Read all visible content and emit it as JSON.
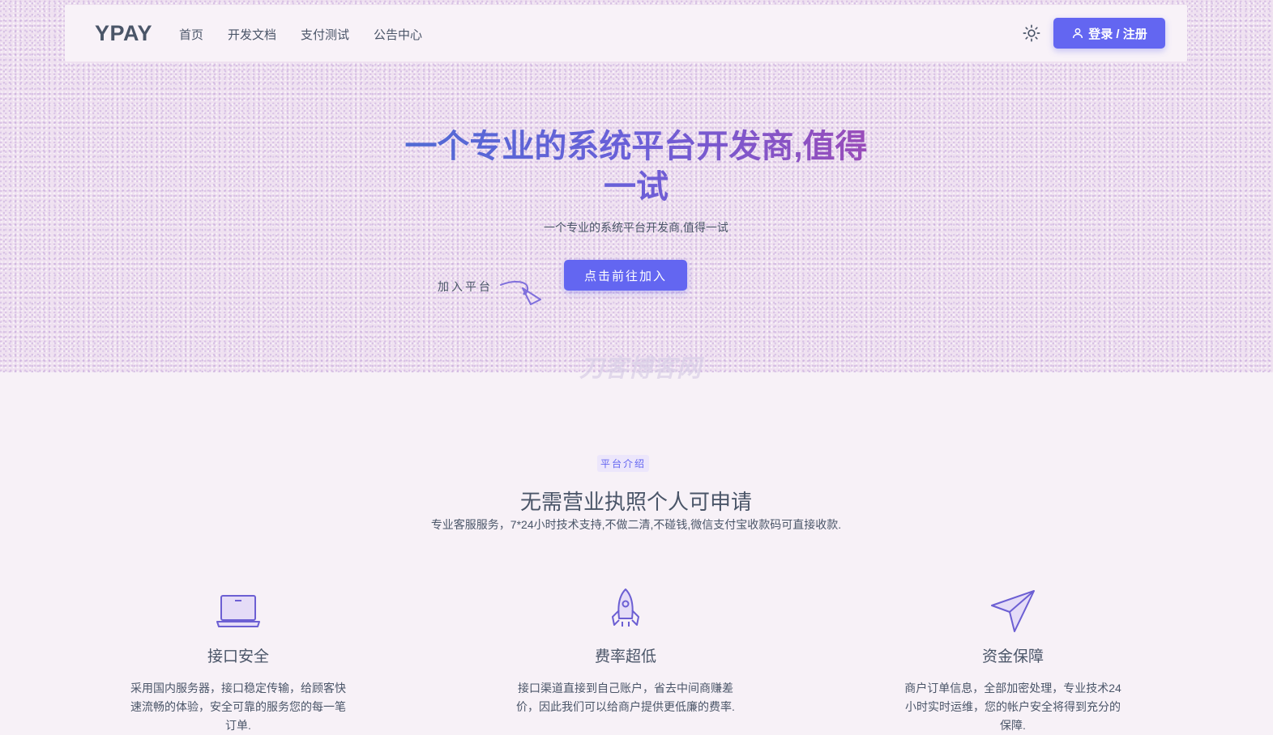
{
  "header": {
    "logo": "YPAY",
    "nav": [
      "首页",
      "开发文档",
      "支付测试",
      "公告中心"
    ],
    "theme_toggle_icon": "sun-icon",
    "login_label": "登录 / 注册",
    "login_icon": "user-icon"
  },
  "hero": {
    "title": "一个专业的系统平台开发商,值得一试",
    "subtitle": "一个专业的系统平台开发商,值得一试",
    "join_label": "加入平台",
    "cta_label": "点击前往加入",
    "watermark": "刀客博客网"
  },
  "intro": {
    "badge": "平台介绍",
    "title": "无需营业执照个人可申请",
    "subtitle": "专业客服服务，7*24小时技术支持,不做二清,不碰钱,微信支付宝收款码可直接收款."
  },
  "features": [
    {
      "icon": "laptop-icon",
      "title": "接口安全",
      "desc": "采用国内服务器，接口稳定传输，给顾客快速流畅的体验，安全可靠的服务您的每一笔订单."
    },
    {
      "icon": "rocket-icon",
      "title": "费率超低",
      "desc": "接口渠道直接到自己账户，省去中间商赚差价，因此我们可以给商户提供更低廉的费率."
    },
    {
      "icon": "paper-plane-icon",
      "title": "资金保障",
      "desc": "商户订单信息，全部加密处理，专业技术24小时实时运维，您的帐户安全将得到充分的保障."
    }
  ],
  "colors": {
    "accent": "#6366f1",
    "text": "#4a5568",
    "background": "#f7f1f7"
  }
}
